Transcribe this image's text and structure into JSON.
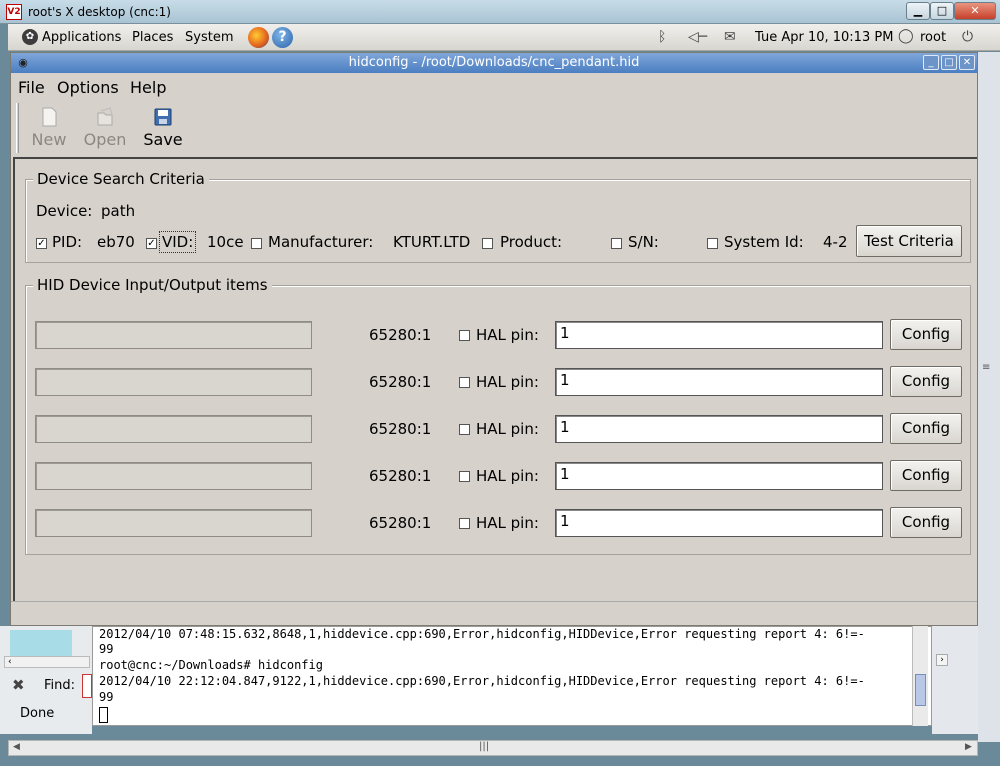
{
  "vnc": {
    "icon_text": "V2",
    "title": "root's X desktop (cnc:1)",
    "min": "▁",
    "max": "□",
    "close": "✕"
  },
  "panel": {
    "menus": [
      "Applications",
      "Places",
      "System"
    ],
    "datetime": "Tue Apr 10, 10:13 PM",
    "user": "root"
  },
  "window": {
    "title": "hidconfig - /root/Downloads/cnc_pendant.hid",
    "menu": [
      "File",
      "Options",
      "Help"
    ],
    "toolbar": [
      {
        "label": "New",
        "enabled": false,
        "icon": "new-document-icon"
      },
      {
        "label": "Open",
        "enabled": false,
        "icon": "open-folder-icon"
      },
      {
        "label": "Save",
        "enabled": true,
        "icon": "save-disk-icon"
      }
    ]
  },
  "search": {
    "legend": "Device Search Criteria",
    "device_label": "Device:",
    "device_value": "path",
    "criteria": [
      {
        "label": "PID:",
        "value": "eb70",
        "checked": true
      },
      {
        "label": "VID:",
        "value": "10ce",
        "checked": true
      },
      {
        "label": "Manufacturer:",
        "value": "KTURT.LTD",
        "checked": false
      },
      {
        "label": "Product:",
        "value": "",
        "checked": false
      },
      {
        "label": "S/N:",
        "value": "",
        "checked": false
      },
      {
        "label": "System Id:",
        "value": "4-2",
        "checked": false
      }
    ],
    "test_button": "Test Criteria"
  },
  "io": {
    "legend": "HID Device Input/Output items",
    "rows": [
      {
        "usage": "65280:1",
        "hal_label": "HAL pin:",
        "pin": "1",
        "config": "Config"
      },
      {
        "usage": "65280:1",
        "hal_label": "HAL pin:",
        "pin": "1",
        "config": "Config"
      },
      {
        "usage": "65280:1",
        "hal_label": "HAL pin:",
        "pin": "1",
        "config": "Config"
      },
      {
        "usage": "65280:1",
        "hal_label": "HAL pin:",
        "pin": "1",
        "config": "Config"
      },
      {
        "usage": "65280:1",
        "hal_label": "HAL pin:",
        "pin": "1",
        "config": "Config"
      }
    ]
  },
  "terminal": {
    "lines": [
      "2012/04/10 07:48:15.632,8648,1,hiddevice.cpp:690,Error,hidconfig,HIDDevice,Error requesting report 4: 6!=-",
      "99",
      "root@cnc:~/Downloads# hidconfig",
      "2012/04/10 22:12:04.847,9122,1,hiddevice.cpp:690,Error,hidconfig,HIDDevice,Error requesting report 4: 6!=-",
      "99"
    ]
  },
  "browser": {
    "find_label": "Find:",
    "status": "Done"
  }
}
